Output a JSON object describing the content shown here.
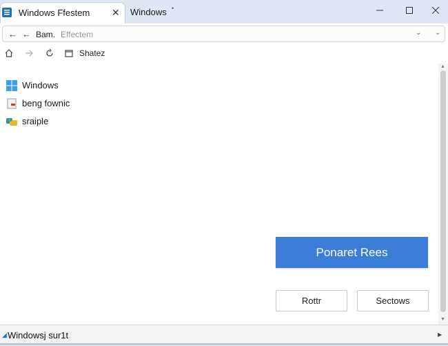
{
  "tabs": [
    {
      "title": "Windows Ffestem",
      "active": true
    },
    {
      "title": "Windows",
      "active": false
    }
  ],
  "address": {
    "text": "Bam.",
    "placeholder": "Effectem"
  },
  "toolbar": {
    "label": "Shatez"
  },
  "items": [
    {
      "label": "Windows",
      "icon": "windows-logo-icon"
    },
    {
      "label": "beng fownic",
      "icon": "document-icon"
    },
    {
      "label": "sraiple",
      "icon": "app-icon"
    }
  ],
  "buttons": {
    "primary": "Ponaret Rees",
    "left": "Rottr",
    "right": "Sectows"
  },
  "status": {
    "text": "Windowsj sur1t"
  },
  "colors": {
    "accent": "#3b7dd8",
    "titlebar": "#dfe6f4"
  }
}
